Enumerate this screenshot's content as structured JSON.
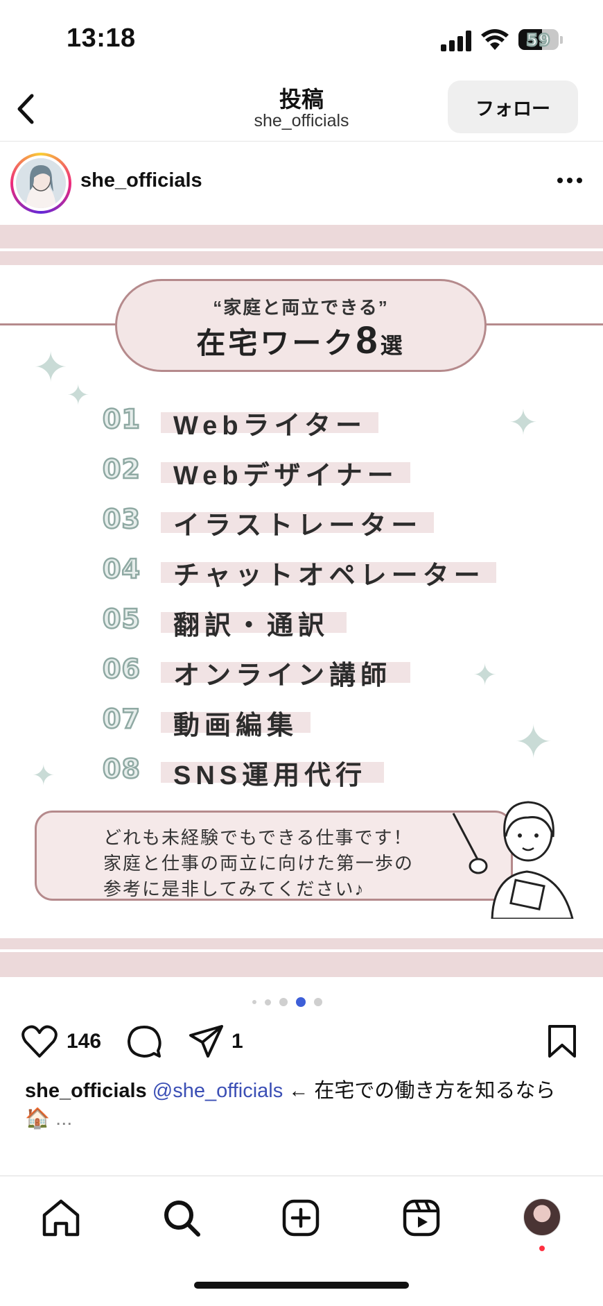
{
  "status_bar": {
    "time": "13:18",
    "battery": "59",
    "battery_level": 0.59
  },
  "header": {
    "title": "投稿",
    "subtitle": "she_officials",
    "follow_label": "フォロー"
  },
  "post": {
    "username": "she_officials",
    "image": {
      "title_sub": "“家庭と両立できる”",
      "title_main": "在宅ワーク",
      "title_num": "8",
      "title_suffix": "選",
      "items": [
        {
          "num": "01",
          "label": "Webライター"
        },
        {
          "num": "02",
          "label": "Webデザイナー"
        },
        {
          "num": "03",
          "label": "イラストレーター"
        },
        {
          "num": "04",
          "label": "チャットオペレーター"
        },
        {
          "num": "05",
          "label": "翻訳・通訳"
        },
        {
          "num": "06",
          "label": "オンライン講師"
        },
        {
          "num": "07",
          "label": "動画編集"
        },
        {
          "num": "08",
          "label": "SNS運用代行"
        }
      ],
      "message": [
        "どれも未経験でもできる仕事です！",
        "家庭と仕事の両立に向けた第一歩の",
        "参考に是非してみてください♪"
      ]
    },
    "carousel": {
      "total": 5,
      "active": 4
    },
    "likes": "146",
    "shares": "1",
    "caption": {
      "username": "she_officials",
      "mention": "@she_officials",
      "text": " ← 在宅での働き方を知るなら",
      "emoji": "🏠",
      "ellipsis": " ..."
    }
  },
  "colors": {
    "accent_pink": "#ecd9da",
    "border_rose": "#b58a8c",
    "star_mint": "#c9dbd6",
    "mention_blue": "#3b4fb5",
    "notify_red": "#ff3040"
  },
  "nav_icons": [
    "home-icon",
    "search-icon",
    "create-icon",
    "reels-icon",
    "profile-avatar"
  ]
}
